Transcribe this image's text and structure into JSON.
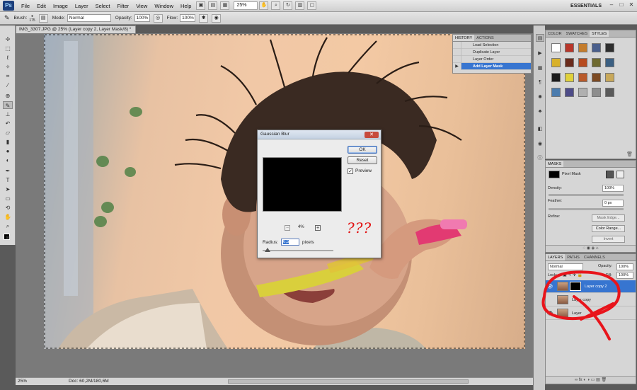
{
  "app": {
    "logo": "Ps",
    "zoom": "25%",
    "workspace": "ESSENTIALS"
  },
  "menu": [
    "File",
    "Edit",
    "Image",
    "Layer",
    "Select",
    "Filter",
    "View",
    "Window",
    "Help"
  ],
  "options_bar": {
    "brush_label": "Brush:",
    "brush_size": "175",
    "mode_label": "Mode:",
    "mode_value": "Normal",
    "opacity_label": "Opacity:",
    "opacity_value": "100%",
    "flow_label": "Flow:",
    "flow_value": "100%"
  },
  "document": {
    "tab_title": "IMG_3307.JPG @ 25% (Layer copy 2, Layer Mask/8) *",
    "status_zoom": "25%",
    "status_doc": "Doc: 60,2M/180,6M"
  },
  "history": {
    "tabs": [
      "HISTORY",
      "ACTIONS"
    ],
    "items": [
      {
        "label": "Load Selection"
      },
      {
        "label": "Duplicate Layer"
      },
      {
        "label": "Layer Order"
      },
      {
        "label": "Add Layer Mask"
      }
    ],
    "selected_index": 3
  },
  "styles_panel": {
    "tabs": [
      "COLOR",
      "SWATCHES",
      "STYLES"
    ],
    "swatch_colors": [
      "#ffffff",
      "#b8362a",
      "#c47d2d",
      "#4a5f8c",
      "#2e2e2e",
      "#d8b12a",
      "#6b2b1c",
      "#b74b1f",
      "#6f6a2f",
      "#3b5f82",
      "#1b1b1b",
      "#e0d13b",
      "#b95a2a",
      "#7d4a22",
      "#c8a85a",
      "#4b7cae",
      "#4e4c88",
      "#b0b0b0",
      "#8e8e8e",
      "#5a5a5a"
    ]
  },
  "masks": {
    "tab": "MASKS",
    "pixel_mask": "Pixel Mask",
    "density_label": "Density:",
    "density_value": "100%",
    "feather_label": "Feather:",
    "feather_value": "0 px",
    "refine_label": "Refine:",
    "mask_edge_btn": "Mask Edge...",
    "color_range_btn": "Color Range...",
    "invert_btn": "Invert"
  },
  "layers": {
    "tabs": [
      "LAYERS",
      "PATHS",
      "CHANNELS"
    ],
    "blend_mode": "Normal",
    "opacity_label": "Opacity:",
    "opacity_value": "100%",
    "lock_label": "Lock:",
    "fill_label": "Fill:",
    "fill_value": "100%",
    "items": [
      {
        "name": "Layer copy 2",
        "visible": true,
        "selected": true,
        "has_mask": true
      },
      {
        "name": "Layer copy",
        "visible": false,
        "selected": false,
        "has_mask": false
      },
      {
        "name": "Layer",
        "visible": true,
        "selected": false,
        "has_mask": false
      }
    ]
  },
  "dialog": {
    "title": "Gaussian Blur",
    "ok": "OK",
    "reset": "Reset",
    "preview_label": "Preview",
    "preview_checked": true,
    "zoom_value": "4%",
    "radius_label": "Radius:",
    "radius_value": "0,5",
    "radius_unit": "pixels",
    "annotation": "???"
  },
  "annotation_color": "#e8141b"
}
